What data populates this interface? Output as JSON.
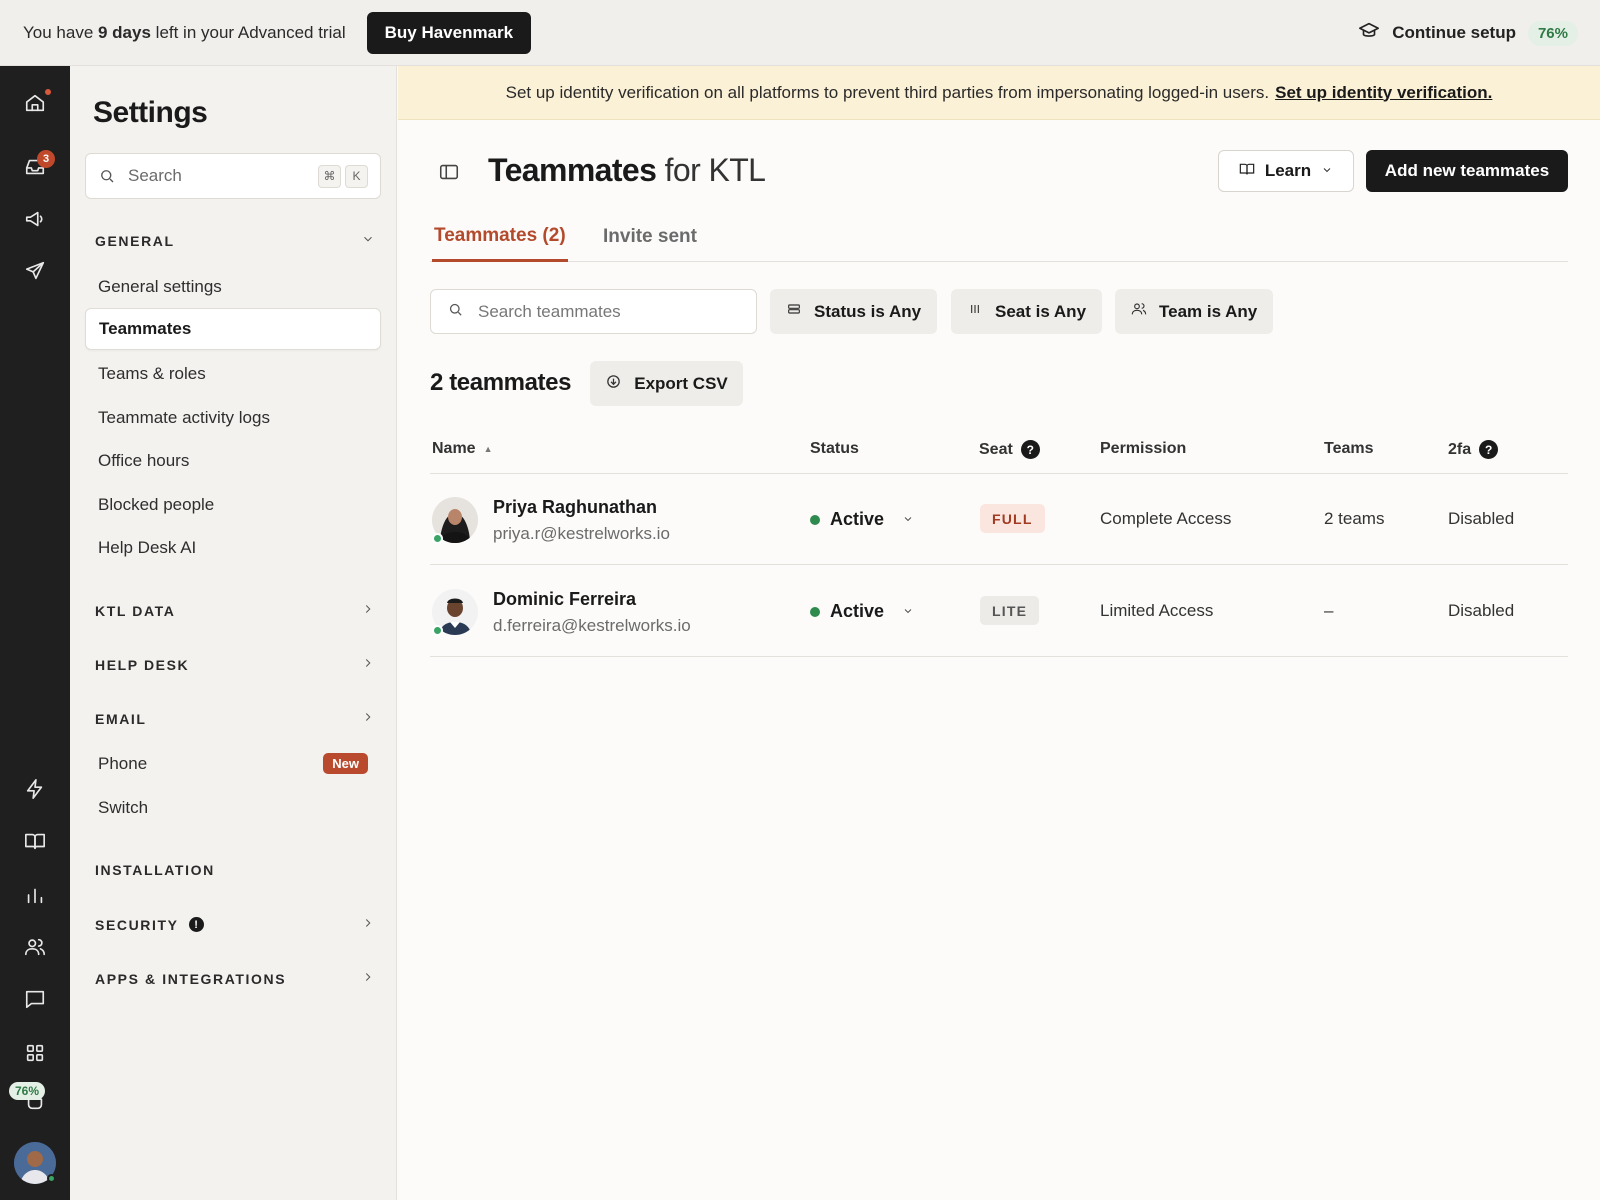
{
  "trial": {
    "prefix": "You have ",
    "days": "9 days",
    "suffix": " left in your Advanced trial",
    "buy_label": "Buy Havenmark",
    "setup_label": "Continue setup",
    "setup_pct": "76%"
  },
  "rail": {
    "inbox_badge": "3",
    "setup_pct": "76%",
    "icons": [
      "home-icon",
      "inbox-icon",
      "megaphone-icon",
      "send-icon",
      "lightning-icon",
      "book-icon",
      "chart-icon",
      "people-icon",
      "chat-icon",
      "apps-icon",
      "setup-icon"
    ]
  },
  "settings": {
    "title": "Settings",
    "search_placeholder": "Search",
    "kbd_cmd": "⌘",
    "kbd_k": "K",
    "general_head": "GENERAL",
    "general_items": [
      "General settings",
      "Teammates",
      "Teams & roles",
      "Teammate activity logs",
      "Office hours",
      "Blocked people",
      "Help Desk AI"
    ],
    "ktl_data_head": "KTL DATA",
    "help_desk_head": "HELP DESK",
    "email_head": "EMAIL",
    "phone_label": "Phone",
    "new_badge": "New",
    "switch_label": "Switch",
    "installation_head": "INSTALLATION",
    "security_head": "SECURITY",
    "security_alert": "!",
    "apps_head": "APPS & INTEGRATIONS"
  },
  "banner": {
    "text": "Set up identity verification on all platforms to prevent third parties from impersonating logged-in users.",
    "link": "Set up identity verification."
  },
  "header": {
    "title_strong": "Teammates",
    "title_light": " for KTL",
    "learn_label": "Learn",
    "add_label": "Add new teammates"
  },
  "tabs": [
    {
      "label": "Teammates (2)",
      "active": true
    },
    {
      "label": "Invite sent",
      "active": false
    }
  ],
  "filters": {
    "search_placeholder": "Search teammates",
    "status": "Status is Any",
    "seat": "Seat is Any",
    "team": "Team is Any"
  },
  "list": {
    "count_title": "2 teammates",
    "export_label": "Export CSV",
    "columns": {
      "name": "Name",
      "status": "Status",
      "seat": "Seat",
      "permission": "Permission",
      "teams": "Teams",
      "twofa": "2fa"
    },
    "help_glyph": "?",
    "rows": [
      {
        "name": "Priya Raghunathan",
        "email": "priya.r@kestrelworks.io",
        "status": "Active",
        "seat": "FULL",
        "permission": "Complete Access",
        "teams": "2 teams",
        "twofa": "Disabled"
      },
      {
        "name": "Dominic Ferreira",
        "email": "d.ferreira@kestrelworks.io",
        "status": "Active",
        "seat": "LITE",
        "permission": "Limited Access",
        "teams": "–",
        "twofa": "Disabled"
      }
    ]
  },
  "colors": {
    "accent": "#b44a2c",
    "active_green": "#2f8a4e",
    "banner_bg": "#fbf1d6",
    "rail_bg": "#1f1f1f"
  }
}
